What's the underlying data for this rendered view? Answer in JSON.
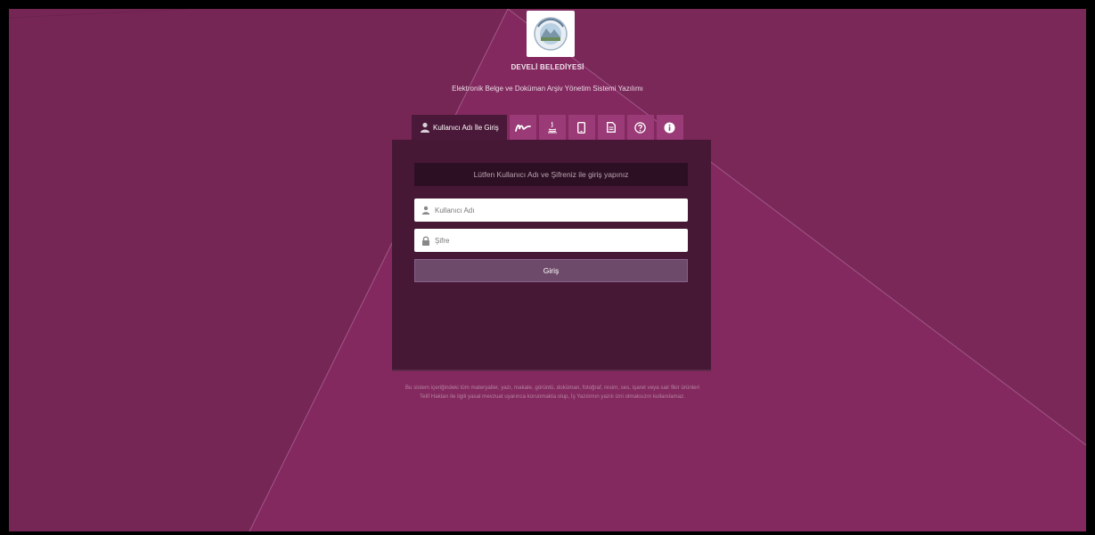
{
  "header": {
    "org_name": "DEVELİ BELEDİYESİ",
    "app_title": "Elektronik Belge ve Doküman Arşiv Yönetim Sistemi Yazılımı",
    "logo_icon": "municipality-seal-icon"
  },
  "tabs": [
    {
      "label": "Kullanıcı Adı İle Giriş",
      "icon": "user-icon",
      "active": true
    },
    {
      "icon": "signature-icon"
    },
    {
      "icon": "java-icon"
    },
    {
      "icon": "mobile-icon"
    },
    {
      "icon": "document-icon"
    },
    {
      "icon": "help-icon"
    },
    {
      "icon": "info-icon"
    }
  ],
  "login": {
    "notice": "Lütfen Kullanıcı Adı ve Şifreniz ile giriş yapınız",
    "username_placeholder": "Kullanıcı Adı",
    "username_value": "",
    "password_placeholder": "Şifre",
    "password_value": "",
    "submit_label": "Giriş"
  },
  "footer": {
    "copyright": "Bu sistem içeriğindeki tüm materyaller, yazı, makale, görüntü, doküman, fotoğraf, resim, ses, işaret veya sair fikir ürünleri Telif Hakları ile ilgili yasal mevzuat uyarınca korunmakta olup, İş Yazılımın yazılı izni olmaksızın kullanılamaz."
  },
  "colors": {
    "background": "#7e2a5b",
    "panel": "#461835",
    "tab": "#9a3a76",
    "button": "#6e4a6a"
  }
}
